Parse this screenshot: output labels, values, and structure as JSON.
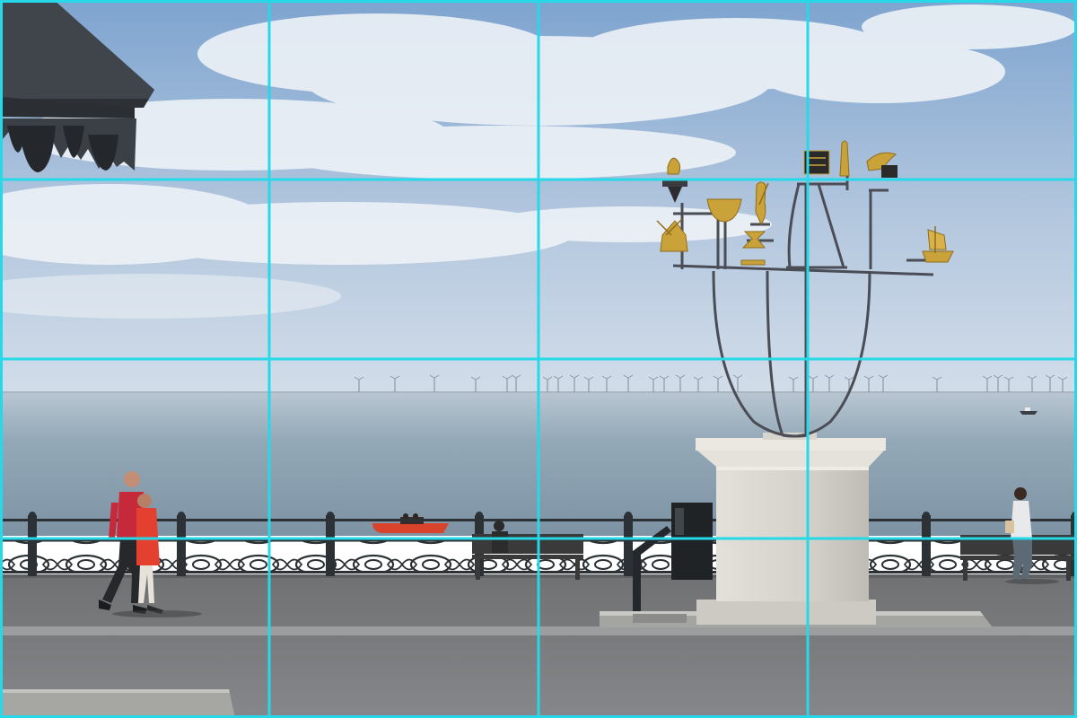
{
  "image": {
    "kind": "photograph",
    "subject": "seafront-promenade",
    "overlay": "rule-of-thirds-grid"
  },
  "colors": {
    "sky_top": "#7fa6d0",
    "sky_bottom": "#c9d8e8",
    "sea_far": "#b9c7d3",
    "sea_near": "#7f95a5",
    "promenade": "#7c7d7e",
    "railing": "#2b3134",
    "pedestal": "#d9d6d0",
    "sculpture_frame": "#4a4d55",
    "gold": "#c9a23a",
    "grid": "#27d8e8"
  },
  "grid": {
    "columns": 4,
    "rows": 4
  }
}
